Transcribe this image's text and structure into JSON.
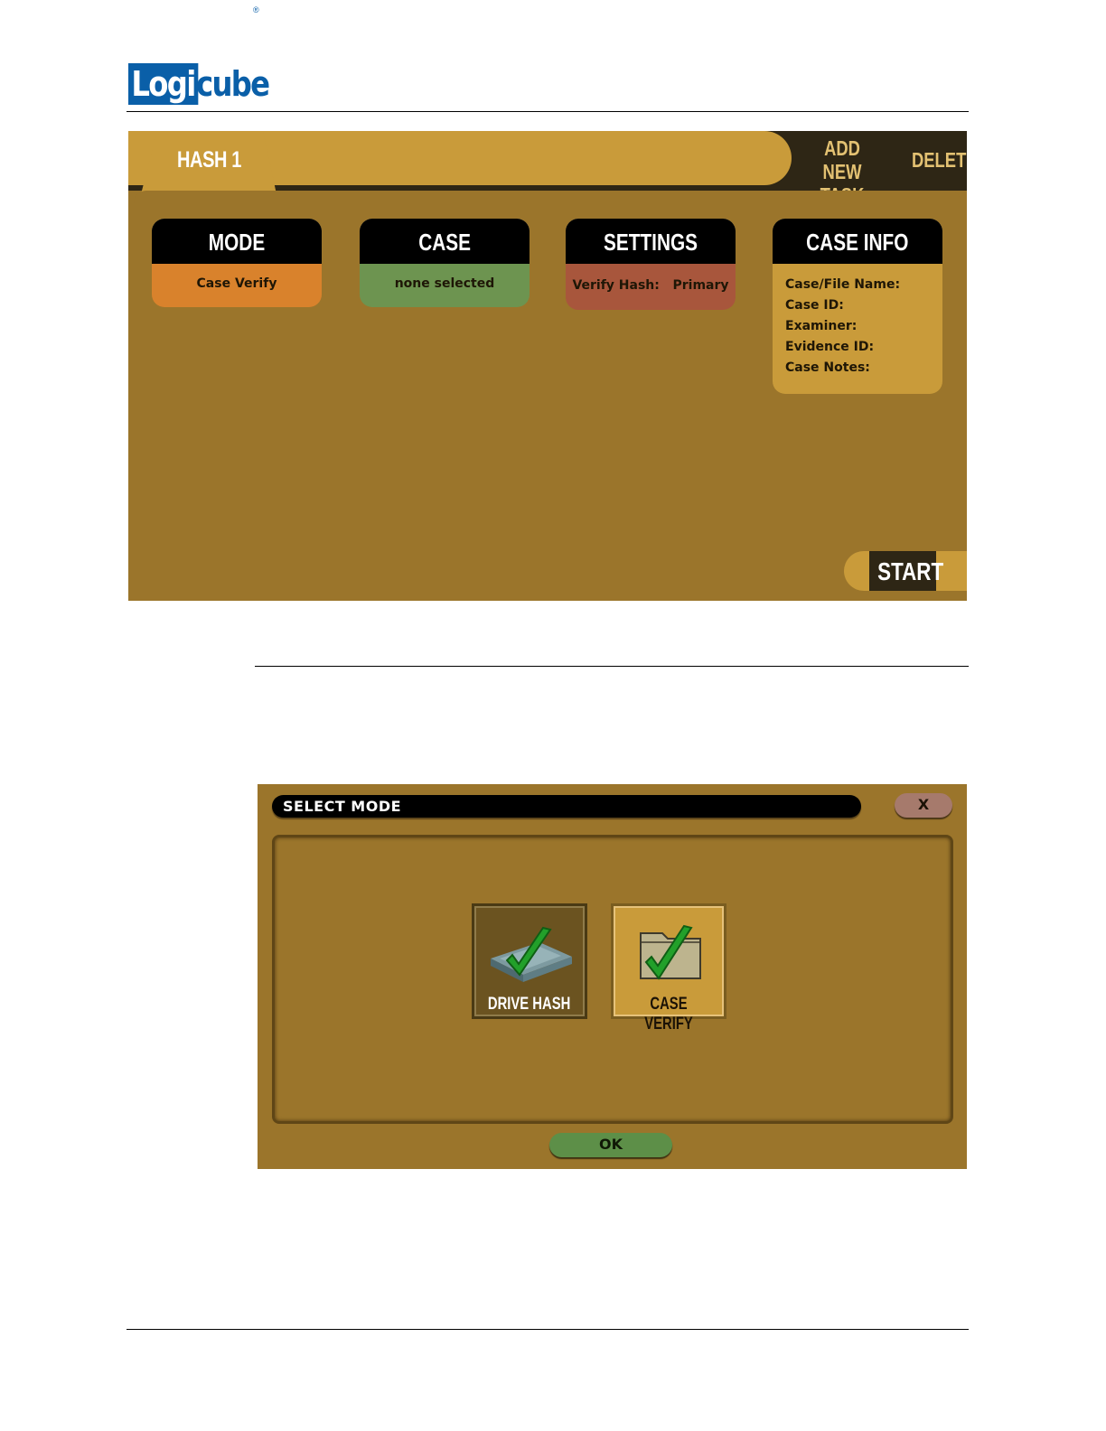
{
  "brand": {
    "logo_boxed": "Logi",
    "logo_rest": "cube",
    "logo_mark": "®"
  },
  "task_screen": {
    "tab_label": "HASH 1",
    "add_task_line1": "ADD NEW",
    "add_task_line2": "TASK",
    "delete_label": "DELETE",
    "mode": {
      "title": "MODE",
      "value": "Case Verify"
    },
    "case": {
      "title": "CASE",
      "value": "none selected"
    },
    "settings": {
      "title": "SETTINGS",
      "value": "Verify Hash:   Primary"
    },
    "case_info": {
      "title": "CASE INFO",
      "fields": [
        "Case/File Name:",
        "Case ID:",
        "Examiner:",
        "Evidence ID:",
        "Case Notes:"
      ]
    },
    "start_label": "START"
  },
  "select_mode_dialog": {
    "title": "SELECT MODE",
    "close_label": "X",
    "options": [
      {
        "label": "DRIVE HASH",
        "icon": "drive-check-icon"
      },
      {
        "label": "CASE VERIFY",
        "icon": "folder-check-icon"
      }
    ],
    "ok_label": "OK"
  },
  "colors": {
    "logo_blue": "#0a5fa8",
    "panel_bg": "#9b752b",
    "tab_gold": "#c99b3a",
    "mode_orange": "#d9822c",
    "case_green": "#6d9450",
    "settings_red": "#a8563c",
    "ok_green": "#5d8f48",
    "check_green": "#22a02a"
  }
}
